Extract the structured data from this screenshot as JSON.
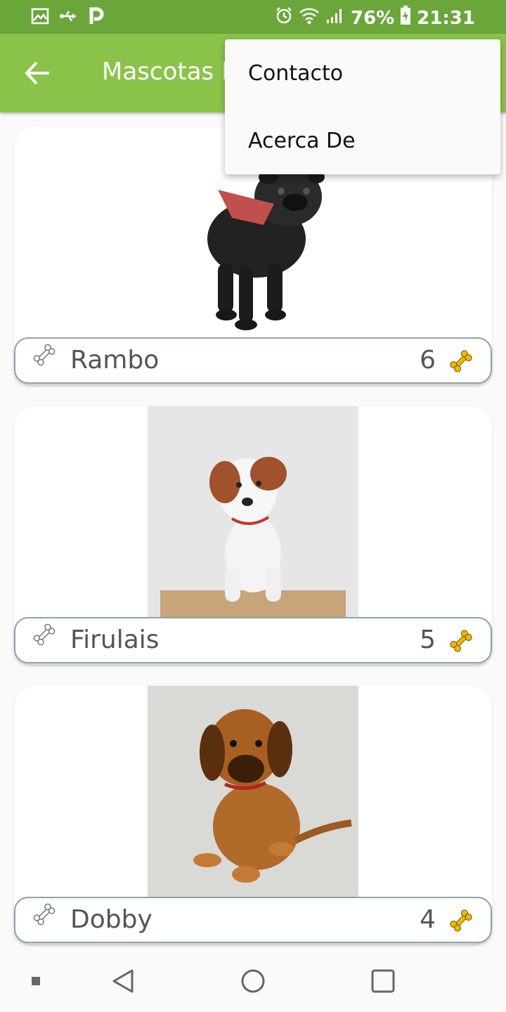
{
  "status_bar": {
    "battery": "76%",
    "time": "21:31"
  },
  "app_bar": {
    "title": "Mascotas Favoritas",
    "back_icon": "arrow-left-icon"
  },
  "overflow_menu": {
    "items": [
      {
        "label": "Contacto"
      },
      {
        "label": "Acerca De"
      }
    ]
  },
  "pets": [
    {
      "name": "Rambo",
      "rating": "6"
    },
    {
      "name": "Firulais",
      "rating": "5"
    },
    {
      "name": "Dobby",
      "rating": "4"
    }
  ],
  "colors": {
    "status_bar": "#6ba63a",
    "app_bar": "#8bc34a",
    "bone_filled": "#f2b705",
    "card_border": "#8aa6a6"
  },
  "nav_bar": {
    "icons": [
      "square-small-icon",
      "back-triangle-icon",
      "home-circle-icon",
      "recents-square-icon"
    ]
  }
}
